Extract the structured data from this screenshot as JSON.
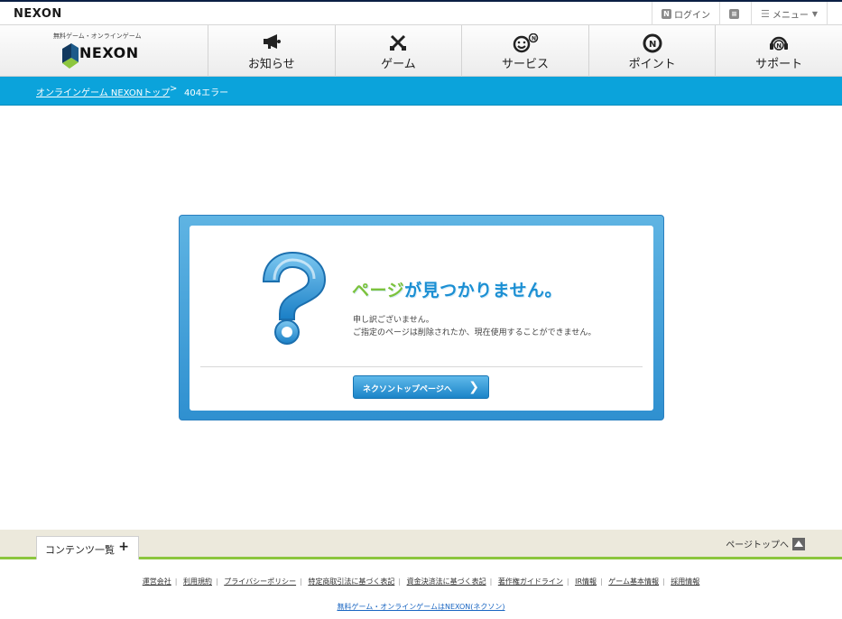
{
  "header": {
    "logo": "NEXON",
    "login": "ログイン",
    "menu": "メニュー"
  },
  "nav": {
    "tagline": "無料ゲーム・オンラインゲーム",
    "brand": "NEXON",
    "items": [
      {
        "label": "お知らせ",
        "icon": "megaphone-icon"
      },
      {
        "label": "ゲーム",
        "icon": "swords-icon"
      },
      {
        "label": "サービス",
        "icon": "smiley-icon"
      },
      {
        "label": "ポイント",
        "icon": "nexon-point-icon"
      },
      {
        "label": "サポート",
        "icon": "headset-icon"
      }
    ]
  },
  "breadcrumb": {
    "home": "オンラインゲーム NEXONトップ",
    "separator": ">",
    "current": "404エラー"
  },
  "error": {
    "title_accent": "ページ",
    "title_rest": "が見つかりません。",
    "line1": "申し訳ございません。",
    "line2": "ご指定のページは削除されたか、現在使用することができません。",
    "button": "ネクソントップページへ"
  },
  "footer": {
    "contents": "コンテンツ一覧",
    "plus": "+",
    "page_top": "ページトップへ",
    "links": [
      "運営会社",
      "利用規約",
      "プライバシーポリシー",
      "特定商取引法に基づく表記",
      "資金決済法に基づく表記",
      "著作権ガイドライン",
      "IR情報",
      "ゲーム基本情報",
      "採用情報"
    ],
    "copyright": "無料ゲーム・オンラインゲームはNEXON(ネクソン)"
  },
  "colors": {
    "nav_blue": "#0ba3db",
    "error_blue": "#1b8fd3",
    "error_green": "#7cc23d",
    "footer_green": "#8cc63e"
  }
}
